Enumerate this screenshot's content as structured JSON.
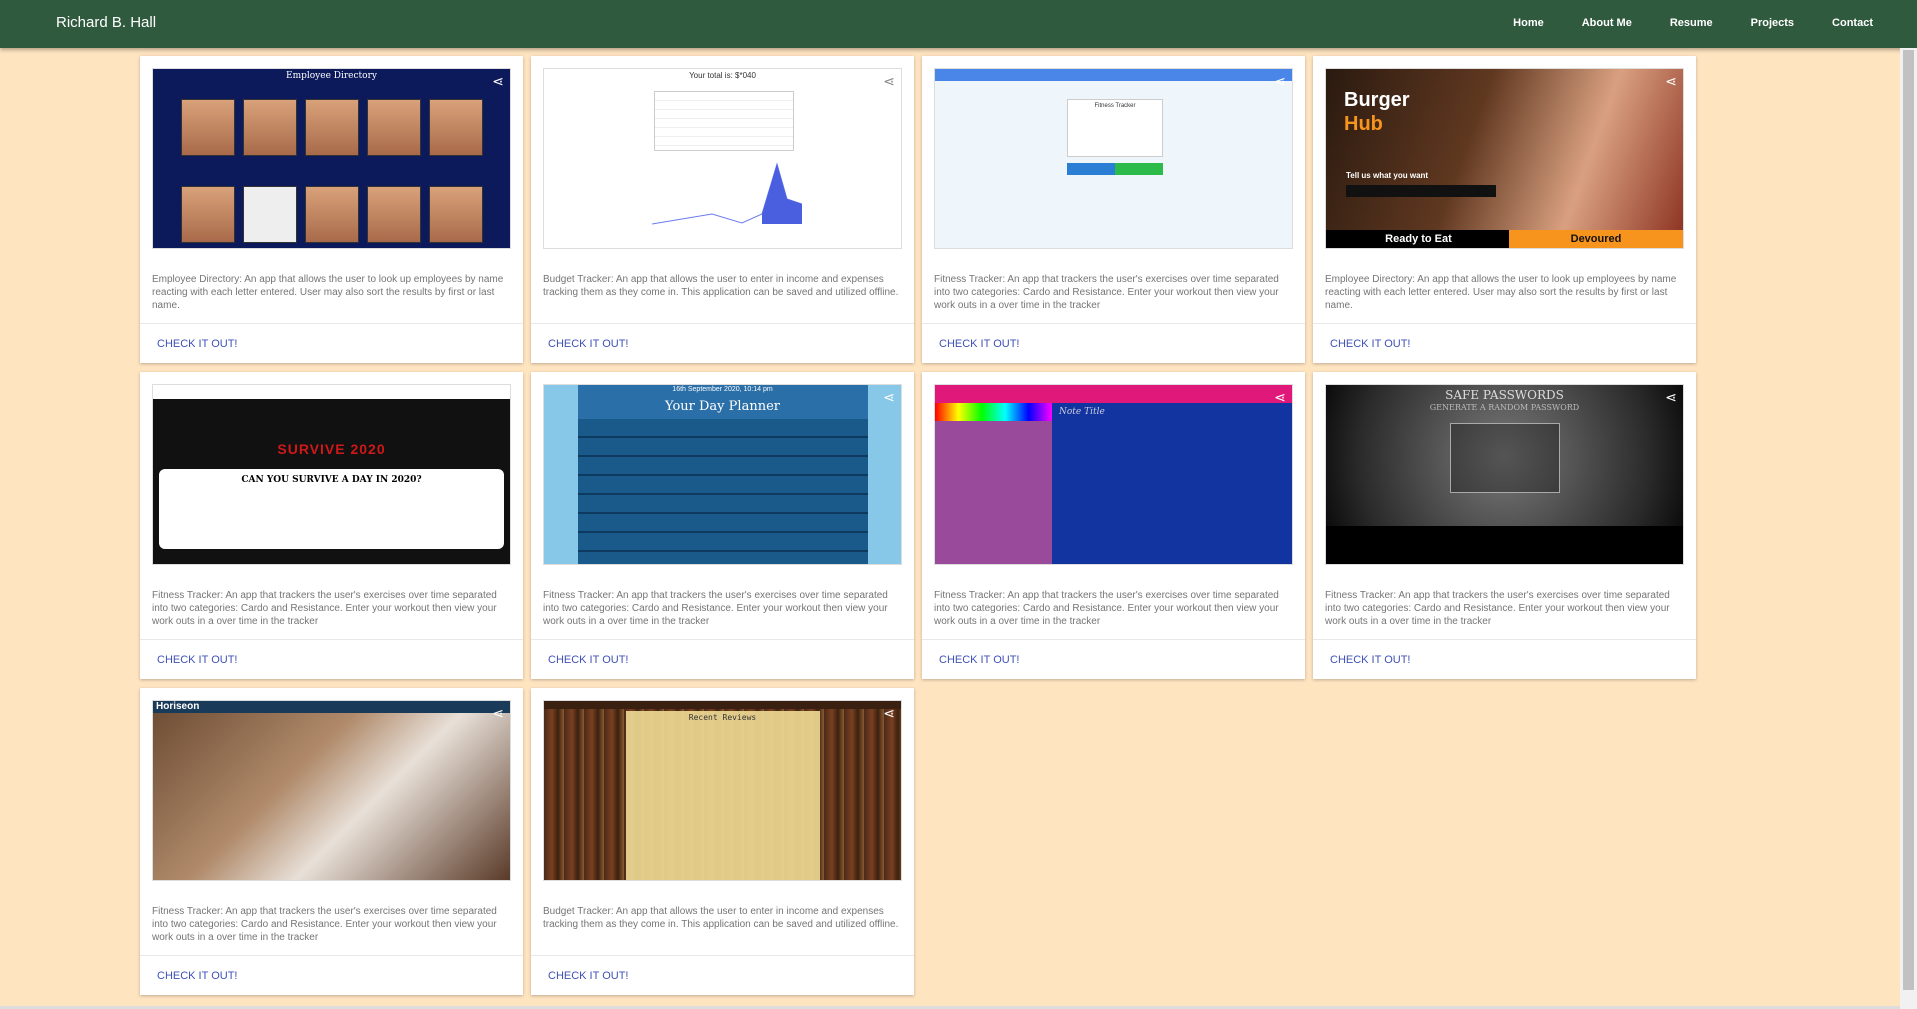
{
  "nav": {
    "brand": "Richard B. Hall",
    "links": [
      "Home",
      "About Me",
      "Resume",
      "Projects",
      "Contact"
    ]
  },
  "cards": [
    {
      "thumb": "employee-directory",
      "description": "Employee Directory: An app that allows the user to look up employees by name reacting with each letter entered. User may also sort the results by first or last name.",
      "action": "CHECK IT OUT!"
    },
    {
      "thumb": "budget-tracker",
      "description": "Budget Tracker: An app that allows the user to enter in income and expenses tracking them as they come in. This application can be saved and utilized offline.",
      "action": "CHECK IT OUT!"
    },
    {
      "thumb": "fitness-tracker",
      "description": "Fitness Tracker: An app that trackers the user's exercises over time separated into two categories: Cardo and Resistance. Enter your workout then view your work outs in a over time in the tracker",
      "action": "CHECK IT OUT!"
    },
    {
      "thumb": "burger-hub",
      "description": "Employee Directory: An app that allows the user to look up employees by name reacting with each letter entered. User may also sort the results by first or last name.",
      "action": "CHECK IT OUT!"
    },
    {
      "thumb": "survive-2020",
      "description": "Fitness Tracker: An app that trackers the user's exercises over time separated into two categories: Cardo and Resistance. Enter your workout then view your work outs in a over time in the tracker",
      "action": "CHECK IT OUT!"
    },
    {
      "thumb": "day-planner",
      "description": "Fitness Tracker: An app that trackers the user's exercises over time separated into two categories: Cardo and Resistance. Enter your workout then view your work outs in a over time in the tracker",
      "action": "CHECK IT OUT!"
    },
    {
      "thumb": "note-taker",
      "description": "Fitness Tracker: An app that trackers the user's exercises over time separated into two categories: Cardo and Resistance. Enter your workout then view your work outs in a over time in the tracker",
      "action": "CHECK IT OUT!"
    },
    {
      "thumb": "safe-passwords",
      "description": "Fitness Tracker: An app that trackers the user's exercises over time separated into two categories: Cardo and Resistance. Enter your workout then view your work outs in a over time in the tracker",
      "action": "CHECK IT OUT!"
    },
    {
      "thumb": "horiseon",
      "description": "Fitness Tracker: An app that trackers the user's exercises over time separated into two categories: Cardo and Resistance. Enter your workout then view your work outs in a over time in the tracker",
      "action": "CHECK IT OUT!"
    },
    {
      "thumb": "book-search",
      "description": "Budget Tracker: An app that allows the user to enter in income and expenses tracking them as they come in. This application can be saved and utilized offline.",
      "action": "CHECK IT OUT!"
    }
  ],
  "thumb_text": {
    "employee_header": "Employee Directory",
    "budget_header": "Your total is: $*040",
    "fitness_header": "Fitness Tracker",
    "burger_title1": "Burger",
    "burger_title2": "Hub",
    "burger_tag": "Tell us what you want",
    "burger_btn1": "Ready to Eat",
    "burger_btn2": "Devoured",
    "survive_title": "SURVIVE 2020",
    "survive_q": "CAN YOU SURVIVE A DAY IN 2020?",
    "planner_date": "16th September 2020, 10:14 pm",
    "planner_title": "Your Day Planner",
    "notes_title": "Note Title",
    "pw_title": "SAFE PASSWORDS",
    "pw_sub": "GENERATE A RANDOM PASSWORD",
    "horiseon_title": "Horiseon",
    "books_title": "Recent Reviews"
  },
  "colors": {
    "navbar": "#2f5a3d",
    "background": "#ffe4c0",
    "action_link": "#3f51b5"
  }
}
